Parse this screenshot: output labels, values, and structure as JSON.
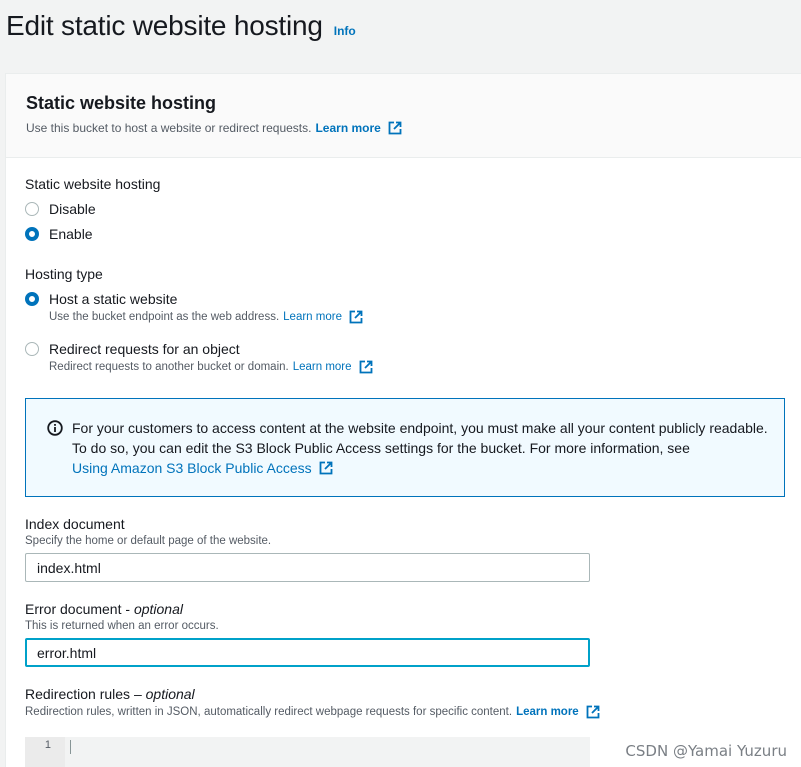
{
  "page": {
    "title": "Edit static website hosting",
    "info_link": "Info"
  },
  "panel": {
    "title": "Static website hosting",
    "description": "Use this bucket to host a website or redirect requests.",
    "learn_more": "Learn more"
  },
  "hosting": {
    "label": "Static website hosting",
    "options": [
      {
        "label": "Disable",
        "selected": false
      },
      {
        "label": "Enable",
        "selected": true
      }
    ]
  },
  "hosting_type": {
    "label": "Hosting type",
    "options": [
      {
        "label": "Host a static website",
        "description": "Use the bucket endpoint as the web address.",
        "learn_more": "Learn more",
        "selected": true
      },
      {
        "label": "Redirect requests for an object",
        "description": "Redirect requests to another bucket or domain.",
        "learn_more": "Learn more",
        "selected": false
      }
    ]
  },
  "alert": {
    "text": "For your customers to access content at the website endpoint, you must make all your content publicly readable. To do so, you can edit the S3 Block Public Access settings for the bucket. For more information, see",
    "link": "Using Amazon S3 Block Public Access"
  },
  "index_document": {
    "label": "Index document",
    "description": "Specify the home or default page of the website.",
    "value": "index.html"
  },
  "error_document": {
    "label": "Error document - ",
    "optional": "optional",
    "description": "This is returned when an error occurs.",
    "value": "error.html"
  },
  "redirection_rules": {
    "label": "Redirection rules – ",
    "optional": "optional",
    "description": "Redirection rules, written in JSON, automatically redirect webpage requests for specific content.",
    "learn_more": "Learn more",
    "line_number": "1"
  },
  "watermark": "CSDN @Yamai Yuzuru",
  "colors": {
    "link": "#0073bb",
    "focus": "#00a1c9",
    "alert_bg": "#f1faff"
  }
}
